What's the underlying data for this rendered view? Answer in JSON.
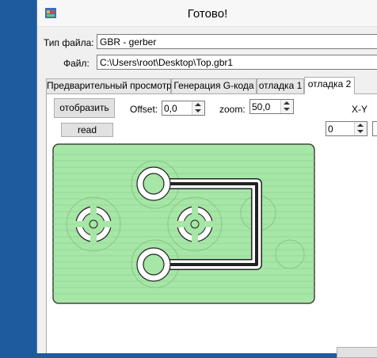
{
  "window": {
    "title": "Готово!"
  },
  "file_type": {
    "label": "Тип файла:",
    "value": "GBR - gerber"
  },
  "file": {
    "label": "Файл:",
    "value": "C:\\Users\\root\\Desktop\\Top.gbr1"
  },
  "tabs": [
    {
      "label": "Предварительный просмотр",
      "active": false
    },
    {
      "label": "Генерация G-кода",
      "active": false
    },
    {
      "label": "отладка 1",
      "active": false
    },
    {
      "label": "отладка 2",
      "active": true
    }
  ],
  "controls": {
    "show_button": "отобразить",
    "read_button": "read",
    "offset_label": "Offset:",
    "offset_value": "0,0",
    "zoom_label": "zoom:",
    "zoom_value": "50,0",
    "xy_label": "X-Y",
    "x_value": "0"
  },
  "colors": {
    "board_fill": "#a6e6a6",
    "board_border": "#444444",
    "title_bg": "#f7f7f7",
    "desktop": "#1e5a9e"
  }
}
